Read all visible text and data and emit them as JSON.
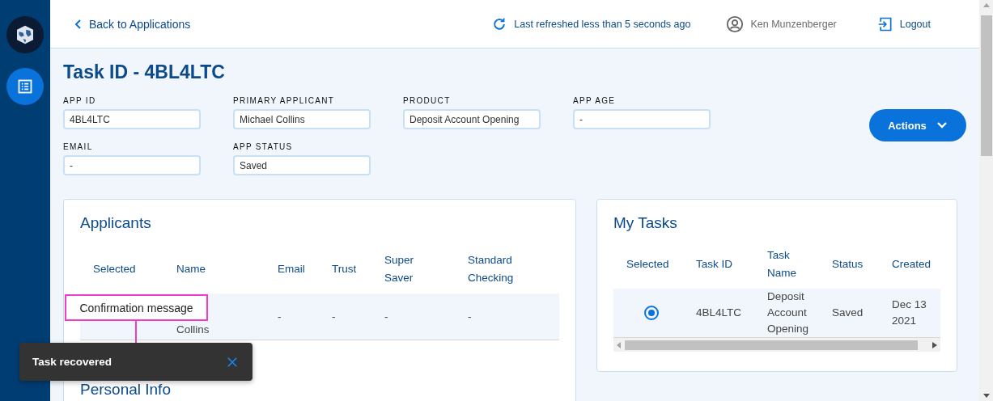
{
  "header": {
    "back_link": "Back to Applications",
    "refresh_status": "Last refreshed less than 5 seconds ago",
    "user_name": "Ken Munzenberger",
    "logout": "Logout"
  },
  "sidebar": {
    "items": [
      {
        "kind": "logo",
        "selected": false
      },
      {
        "kind": "list",
        "selected": true
      }
    ]
  },
  "page_title": "Task ID - 4BL4LTC",
  "fields": [
    {
      "label": "APP ID",
      "value": "4BL4LTC"
    },
    {
      "label": "PRIMARY APPLICANT",
      "value": "Michael Collins"
    },
    {
      "label": "PRODUCT",
      "value": "Deposit Account Opening"
    },
    {
      "label": "APP AGE",
      "value": "-"
    },
    {
      "label": "EMAIL",
      "value": "-"
    },
    {
      "label": "APP STATUS",
      "value": "Saved"
    }
  ],
  "actions_button": "Actions",
  "applicants": {
    "title": "Applicants",
    "columns": [
      "Selected",
      "Name",
      "Email",
      "Trust",
      "Super Saver",
      "Standard Checking"
    ],
    "rows": [
      {
        "cells": [
          "",
          "Collins",
          "-",
          "-",
          "-",
          "-"
        ]
      }
    ]
  },
  "personal_info": {
    "title": "Personal Info"
  },
  "my_tasks": {
    "title": "My Tasks",
    "columns": [
      "Selected",
      "Task ID",
      "Task Name",
      "Status",
      "Created"
    ],
    "rows": [
      {
        "selected": true,
        "cells": [
          "",
          "4BL4LTC",
          "Deposit Account Opening",
          "Saved",
          "Dec 13 2021"
        ]
      }
    ]
  },
  "toast": {
    "message": "Task recovered"
  },
  "annotation": {
    "label": "Confirmation message"
  }
}
